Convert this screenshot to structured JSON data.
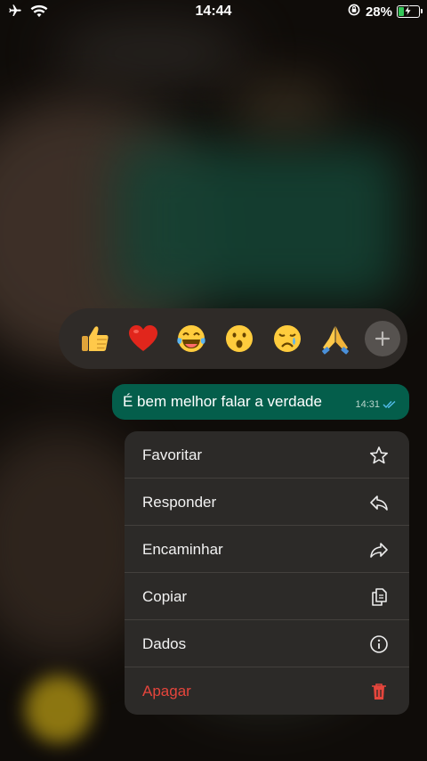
{
  "status_bar": {
    "time": "14:44",
    "battery_percent": "28%",
    "battery_level": 0.28,
    "icons": [
      "airplane-icon",
      "wifi-icon",
      "orientation-lock-icon",
      "battery-charging-icon"
    ]
  },
  "reactions": {
    "emojis": [
      {
        "name": "thumbs-up",
        "glyph": "👍"
      },
      {
        "name": "red-heart",
        "glyph": "❤️"
      },
      {
        "name": "face-with-tears-of-joy",
        "glyph": "😂"
      },
      {
        "name": "face-with-open-mouth",
        "glyph": "😮"
      },
      {
        "name": "crying-face",
        "glyph": "😢"
      },
      {
        "name": "folded-hands",
        "glyph": "🙏"
      }
    ],
    "more_icon": "plus-icon"
  },
  "message": {
    "text": "É bem melhor falar a verdade",
    "time": "14:31",
    "status_icon": "double-check-icon",
    "bubble_color": "#045e4b"
  },
  "menu": {
    "items": [
      {
        "label": "Favoritar",
        "icon": "star-icon"
      },
      {
        "label": "Responder",
        "icon": "reply-icon"
      },
      {
        "label": "Encaminhar",
        "icon": "forward-icon"
      },
      {
        "label": "Copiar",
        "icon": "copy-icon"
      },
      {
        "label": "Dados",
        "icon": "info-icon"
      },
      {
        "label": "Apagar",
        "icon": "trash-icon"
      }
    ],
    "danger_color": "#e5453c"
  }
}
